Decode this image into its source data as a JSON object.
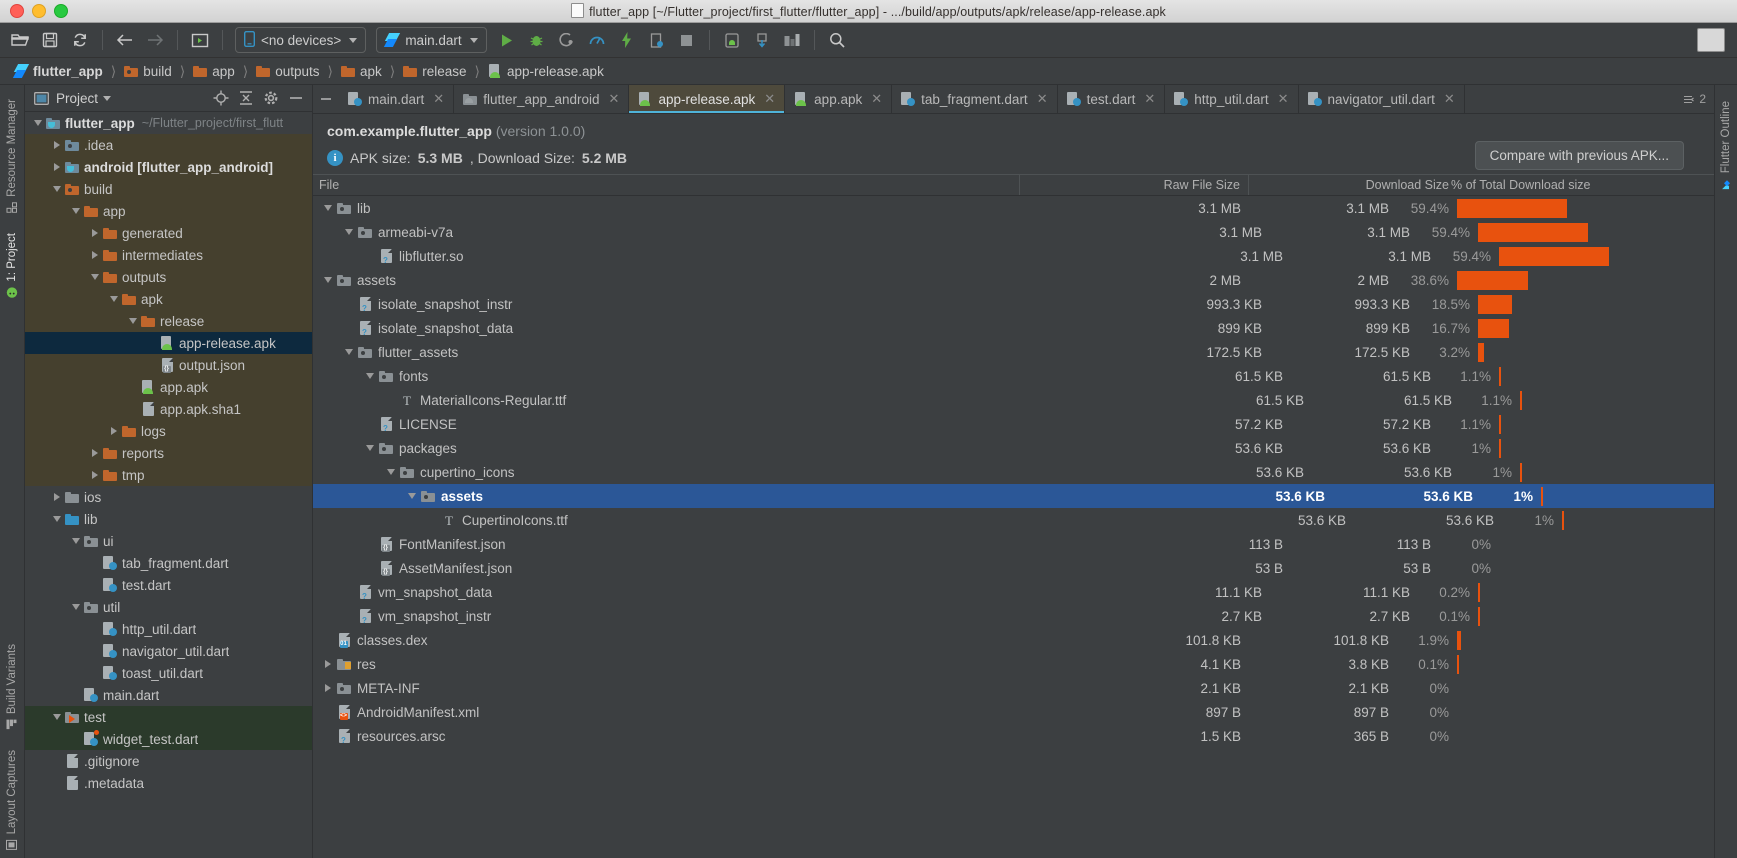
{
  "window": {
    "title": "flutter_app [~/Flutter_project/first_flutter/flutter_app] - .../build/app/outputs/apk/release/app-release.apk"
  },
  "toolbar": {
    "device_selector": "<no devices>",
    "run_config": "main.dart",
    "icons": [
      "open-folder-icon",
      "save-icon",
      "sync-icon",
      "back-icon",
      "forward-icon",
      "open-preview-icon",
      "device-icon",
      "flutter-icon",
      "run-icon",
      "debug-icon",
      "coverage-icon",
      "profile-icon",
      "flash-icon",
      "attach-debugger-icon",
      "stop-icon",
      "avd-manager-icon",
      "sdk-manager-icon",
      "layout-inspector-icon",
      "search-icon"
    ]
  },
  "breadcrumb": [
    {
      "label": "flutter_app",
      "icon": "flutter-icon",
      "bold": true
    },
    {
      "label": "build",
      "icon": "folder-build-icon",
      "bold": false
    },
    {
      "label": "app",
      "icon": "folder-icon",
      "bold": false
    },
    {
      "label": "outputs",
      "icon": "folder-icon",
      "bold": false
    },
    {
      "label": "apk",
      "icon": "folder-icon",
      "bold": false
    },
    {
      "label": "release",
      "icon": "folder-icon",
      "bold": false
    },
    {
      "label": "app-release.apk",
      "icon": "apk-icon",
      "bold": false
    }
  ],
  "left_strip": [
    {
      "label": "Resource Manager",
      "icon": "resource-manager-icon",
      "active": false
    },
    {
      "label": "1: Project",
      "icon": "project-icon",
      "active": true
    },
    {
      "label": "Build Variants",
      "icon": "build-variants-icon",
      "active": false
    },
    {
      "label": "Layout Captures",
      "icon": "layout-captures-icon",
      "active": false
    }
  ],
  "right_strip": [
    {
      "label": "Flutter Outline",
      "icon": "flutter-outline-icon",
      "active": false
    }
  ],
  "project_panel": {
    "title": "Project",
    "header_icons": [
      "project-view-select-icon",
      "locate-icon",
      "collapse-all-icon",
      "settings-gear-icon",
      "hide-panel-icon"
    ],
    "tree": [
      {
        "label": "flutter_app",
        "sub": "~/Flutter_project/first_flutt",
        "indent": 0,
        "arrow": "down",
        "icon": "module-icon",
        "bold": true,
        "hl": "none"
      },
      {
        "label": ".idea",
        "sub": "",
        "indent": 1,
        "arrow": "right",
        "icon": "folder-idea-icon",
        "bold": false,
        "hl": "build"
      },
      {
        "label": "android [flutter_app_android]",
        "sub": "",
        "indent": 1,
        "arrow": "right",
        "icon": "module-icon",
        "bold": true,
        "hl": "build"
      },
      {
        "label": "build",
        "sub": "",
        "indent": 1,
        "arrow": "down",
        "icon": "folder-build-icon",
        "bold": false,
        "hl": "build"
      },
      {
        "label": "app",
        "sub": "",
        "indent": 2,
        "arrow": "down",
        "icon": "folder-icon",
        "bold": false,
        "hl": "build"
      },
      {
        "label": "generated",
        "sub": "",
        "indent": 3,
        "arrow": "right",
        "icon": "folder-icon",
        "bold": false,
        "hl": "build"
      },
      {
        "label": "intermediates",
        "sub": "",
        "indent": 3,
        "arrow": "right",
        "icon": "folder-icon",
        "bold": false,
        "hl": "build"
      },
      {
        "label": "outputs",
        "sub": "",
        "indent": 3,
        "arrow": "down",
        "icon": "folder-icon",
        "bold": false,
        "hl": "build"
      },
      {
        "label": "apk",
        "sub": "",
        "indent": 4,
        "arrow": "down",
        "icon": "folder-icon",
        "bold": false,
        "hl": "build"
      },
      {
        "label": "release",
        "sub": "",
        "indent": 5,
        "arrow": "down",
        "icon": "folder-icon",
        "bold": false,
        "hl": "build"
      },
      {
        "label": "app-release.apk",
        "sub": "",
        "indent": 6,
        "arrow": "none",
        "icon": "apk-icon",
        "bold": false,
        "hl": "sel"
      },
      {
        "label": "output.json",
        "sub": "",
        "indent": 6,
        "arrow": "none",
        "icon": "json-icon",
        "bold": false,
        "hl": "build"
      },
      {
        "label": "app.apk",
        "sub": "",
        "indent": 5,
        "arrow": "none",
        "icon": "apk-icon",
        "bold": false,
        "hl": "build"
      },
      {
        "label": "app.apk.sha1",
        "sub": "",
        "indent": 5,
        "arrow": "none",
        "icon": "file-icon",
        "bold": false,
        "hl": "build"
      },
      {
        "label": "logs",
        "sub": "",
        "indent": 4,
        "arrow": "right",
        "icon": "folder-icon",
        "bold": false,
        "hl": "build"
      },
      {
        "label": "reports",
        "sub": "",
        "indent": 3,
        "arrow": "right",
        "icon": "folder-icon",
        "bold": false,
        "hl": "build"
      },
      {
        "label": "tmp",
        "sub": "",
        "indent": 3,
        "arrow": "right",
        "icon": "folder-icon",
        "bold": false,
        "hl": "build"
      },
      {
        "label": "ios",
        "sub": "",
        "indent": 1,
        "arrow": "right",
        "icon": "folder-ios-icon",
        "bold": false,
        "hl": "none"
      },
      {
        "label": "lib",
        "sub": "",
        "indent": 1,
        "arrow": "down",
        "icon": "folder-source-icon",
        "bold": false,
        "hl": "none"
      },
      {
        "label": "ui",
        "sub": "",
        "indent": 2,
        "arrow": "down",
        "icon": "folder-gray-icon",
        "bold": false,
        "hl": "none"
      },
      {
        "label": "tab_fragment.dart",
        "sub": "",
        "indent": 3,
        "arrow": "none",
        "icon": "dart-icon",
        "bold": false,
        "hl": "none"
      },
      {
        "label": "test.dart",
        "sub": "",
        "indent": 3,
        "arrow": "none",
        "icon": "dart-icon",
        "bold": false,
        "hl": "none"
      },
      {
        "label": "util",
        "sub": "",
        "indent": 2,
        "arrow": "down",
        "icon": "folder-gray-icon",
        "bold": false,
        "hl": "none"
      },
      {
        "label": "http_util.dart",
        "sub": "",
        "indent": 3,
        "arrow": "none",
        "icon": "dart-icon",
        "bold": false,
        "hl": "none"
      },
      {
        "label": "navigator_util.dart",
        "sub": "",
        "indent": 3,
        "arrow": "none",
        "icon": "dart-icon",
        "bold": false,
        "hl": "none"
      },
      {
        "label": "toast_util.dart",
        "sub": "",
        "indent": 3,
        "arrow": "none",
        "icon": "dart-icon",
        "bold": false,
        "hl": "none"
      },
      {
        "label": "main.dart",
        "sub": "",
        "indent": 2,
        "arrow": "none",
        "icon": "dart-icon",
        "bold": false,
        "hl": "none"
      },
      {
        "label": "test",
        "sub": "",
        "indent": 1,
        "arrow": "down",
        "icon": "folder-test-icon",
        "bold": false,
        "hl": "green"
      },
      {
        "label": "widget_test.dart",
        "sub": "",
        "indent": 2,
        "arrow": "none",
        "icon": "dart-test-icon",
        "bold": false,
        "hl": "green"
      },
      {
        "label": ".gitignore",
        "sub": "",
        "indent": 1,
        "arrow": "none",
        "icon": "file-icon",
        "bold": false,
        "hl": "none"
      },
      {
        "label": ".metadata",
        "sub": "",
        "indent": 1,
        "arrow": "none",
        "icon": "file-icon",
        "bold": false,
        "hl": "none"
      }
    ]
  },
  "editor_tabs": [
    {
      "label": "main.dart",
      "icon": "dart-icon",
      "active": false
    },
    {
      "label": "flutter_app_android",
      "icon": "android-module-icon",
      "active": false
    },
    {
      "label": "app-release.apk",
      "icon": "apk-icon",
      "active": true
    },
    {
      "label": "app.apk",
      "icon": "apk-icon",
      "active": false
    },
    {
      "label": "tab_fragment.dart",
      "icon": "dart-icon",
      "active": false
    },
    {
      "label": "test.dart",
      "icon": "dart-icon",
      "active": false
    },
    {
      "label": "http_util.dart",
      "icon": "dart-icon",
      "active": false
    },
    {
      "label": "navigator_util.dart",
      "icon": "dart-icon",
      "active": false
    }
  ],
  "tabs_overflow_count": "2",
  "apk_info": {
    "package": "com.example.flutter_app",
    "version": "(version 1.0.0)",
    "size_label_prefix": "APK size: ",
    "apk_size": "5.3 MB",
    "download_label": ", Download Size: ",
    "download_size": "5.2 MB",
    "compare_button": "Compare with previous APK..."
  },
  "table": {
    "columns": [
      "File",
      "Raw File Size",
      "Download Size",
      "% of Total Download size"
    ],
    "rows": [
      {
        "name": "lib",
        "indent": 0,
        "arrow": "down",
        "icon": "folder-gray-icon",
        "raw": "3.1 MB",
        "dl": "3.1 MB",
        "pct": "59.4%",
        "bar": 59.4,
        "sel": false
      },
      {
        "name": "armeabi-v7a",
        "indent": 1,
        "arrow": "down",
        "icon": "folder-gray-icon",
        "raw": "3.1 MB",
        "dl": "3.1 MB",
        "pct": "59.4%",
        "bar": 59.4,
        "sel": false
      },
      {
        "name": "libflutter.so",
        "indent": 2,
        "arrow": "none",
        "icon": "unknown-file-icon",
        "raw": "3.1 MB",
        "dl": "3.1 MB",
        "pct": "59.4%",
        "bar": 59.4,
        "sel": false
      },
      {
        "name": "assets",
        "indent": 0,
        "arrow": "down",
        "icon": "folder-gray-icon",
        "raw": "2 MB",
        "dl": "2 MB",
        "pct": "38.6%",
        "bar": 38.6,
        "sel": false
      },
      {
        "name": "isolate_snapshot_instr",
        "indent": 1,
        "arrow": "none",
        "icon": "unknown-file-icon",
        "raw": "993.3 KB",
        "dl": "993.3 KB",
        "pct": "18.5%",
        "bar": 18.5,
        "sel": false
      },
      {
        "name": "isolate_snapshot_data",
        "indent": 1,
        "arrow": "none",
        "icon": "unknown-file-icon",
        "raw": "899 KB",
        "dl": "899 KB",
        "pct": "16.7%",
        "bar": 16.7,
        "sel": false
      },
      {
        "name": "flutter_assets",
        "indent": 1,
        "arrow": "down",
        "icon": "folder-gray-icon",
        "raw": "172.5 KB",
        "dl": "172.5 KB",
        "pct": "3.2%",
        "bar": 3.2,
        "sel": false
      },
      {
        "name": "fonts",
        "indent": 2,
        "arrow": "down",
        "icon": "folder-gray-icon",
        "raw": "61.5 KB",
        "dl": "61.5 KB",
        "pct": "1.1%",
        "bar": 1.1,
        "sel": false
      },
      {
        "name": "MaterialIcons-Regular.ttf",
        "indent": 3,
        "arrow": "none",
        "icon": "font-icon",
        "raw": "61.5 KB",
        "dl": "61.5 KB",
        "pct": "1.1%",
        "bar": 1.1,
        "sel": false
      },
      {
        "name": "LICENSE",
        "indent": 2,
        "arrow": "none",
        "icon": "unknown-file-icon",
        "raw": "57.2 KB",
        "dl": "57.2 KB",
        "pct": "1.1%",
        "bar": 1.1,
        "sel": false
      },
      {
        "name": "packages",
        "indent": 2,
        "arrow": "down",
        "icon": "folder-gray-icon",
        "raw": "53.6 KB",
        "dl": "53.6 KB",
        "pct": "1%",
        "bar": 1.0,
        "sel": false
      },
      {
        "name": "cupertino_icons",
        "indent": 3,
        "arrow": "down",
        "icon": "folder-gray-icon",
        "raw": "53.6 KB",
        "dl": "53.6 KB",
        "pct": "1%",
        "bar": 1.0,
        "sel": false
      },
      {
        "name": "assets",
        "indent": 4,
        "arrow": "down",
        "icon": "folder-gray-icon",
        "raw": "53.6 KB",
        "dl": "53.6 KB",
        "pct": "1%",
        "bar": 1.0,
        "sel": true
      },
      {
        "name": "CupertinoIcons.ttf",
        "indent": 5,
        "arrow": "none",
        "icon": "font-icon",
        "raw": "53.6 KB",
        "dl": "53.6 KB",
        "pct": "1%",
        "bar": 1.0,
        "sel": false
      },
      {
        "name": "FontManifest.json",
        "indent": 2,
        "arrow": "none",
        "icon": "json-icon",
        "raw": "113 B",
        "dl": "113 B",
        "pct": "0%",
        "bar": 0,
        "sel": false
      },
      {
        "name": "AssetManifest.json",
        "indent": 2,
        "arrow": "none",
        "icon": "json-icon",
        "raw": "53 B",
        "dl": "53 B",
        "pct": "0%",
        "bar": 0,
        "sel": false
      },
      {
        "name": "vm_snapshot_data",
        "indent": 1,
        "arrow": "none",
        "icon": "unknown-file-icon",
        "raw": "11.1 KB",
        "dl": "11.1 KB",
        "pct": "0.2%",
        "bar": 0.2,
        "sel": false
      },
      {
        "name": "vm_snapshot_instr",
        "indent": 1,
        "arrow": "none",
        "icon": "unknown-file-icon",
        "raw": "2.7 KB",
        "dl": "2.7 KB",
        "pct": "0.1%",
        "bar": 0.1,
        "sel": false
      },
      {
        "name": "classes.dex",
        "indent": 0,
        "arrow": "none",
        "icon": "dex-icon",
        "raw": "101.8 KB",
        "dl": "101.8 KB",
        "pct": "1.9%",
        "bar": 1.9,
        "sel": false
      },
      {
        "name": "res",
        "indent": 0,
        "arrow": "right",
        "icon": "folder-res-icon",
        "raw": "4.1 KB",
        "dl": "3.8 KB",
        "pct": "0.1%",
        "bar": 0.1,
        "sel": false
      },
      {
        "name": "META-INF",
        "indent": 0,
        "arrow": "right",
        "icon": "folder-gray-icon",
        "raw": "2.1 KB",
        "dl": "2.1 KB",
        "pct": "0%",
        "bar": 0,
        "sel": false
      },
      {
        "name": "AndroidManifest.xml",
        "indent": 0,
        "arrow": "none",
        "icon": "xml-icon",
        "raw": "897 B",
        "dl": "897 B",
        "pct": "0%",
        "bar": 0,
        "sel": false
      },
      {
        "name": "resources.arsc",
        "indent": 0,
        "arrow": "none",
        "icon": "unknown-file-icon",
        "raw": "1.5 KB",
        "dl": "365 B",
        "pct": "0%",
        "bar": 0,
        "sel": false
      }
    ]
  },
  "colors": {
    "bar": "#e8520e",
    "selection": "#2b5797",
    "accent_blue": "#4fb3d9",
    "info_blue": "#3592c4"
  }
}
